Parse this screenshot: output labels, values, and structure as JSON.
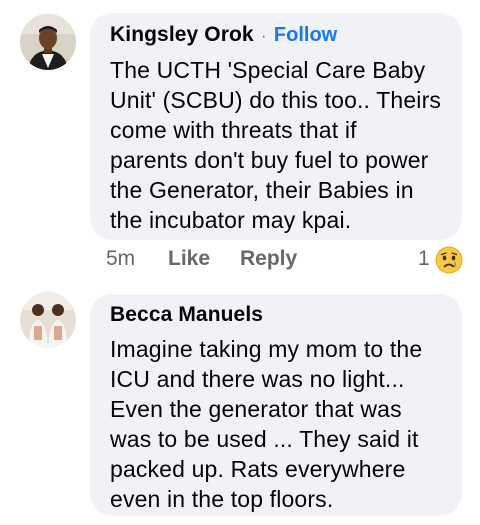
{
  "comments": [
    {
      "author": "Kingsley Orok",
      "separator": "·",
      "follow_label": "Follow",
      "text": "The UCTH 'Special Care Baby\nUnit' (SCBU) do this too.. Theirs\ncome with threats that if\nparents don't buy fuel to power\nthe Generator, their Babies in\nthe incubator may kpai.",
      "timestamp": "5m",
      "like_label": "Like",
      "reply_label": "Reply",
      "reaction_count": "1",
      "reaction_icon": "sad-face-icon"
    },
    {
      "author": "Becca Manuels",
      "text": "Imagine taking my mom to the\nICU and  there was no light...\nEven the generator that was\nwas to be used ... They said it\npacked up. Rats everywhere\neven in the top floors."
    }
  ]
}
